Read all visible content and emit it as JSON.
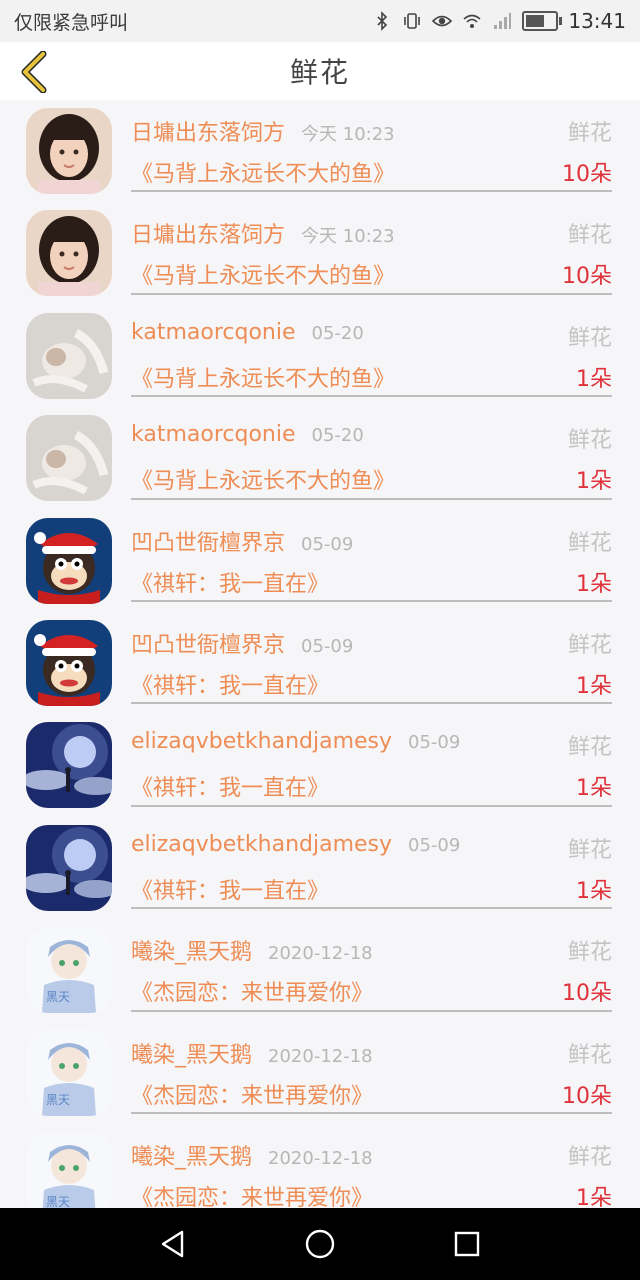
{
  "status_bar": {
    "carrier_text": "仅限紧急呼叫",
    "time": "13:41",
    "icons": [
      "bluetooth-icon",
      "vibrate-icon",
      "eye-icon",
      "wifi-icon",
      "signal-icon",
      "battery-icon"
    ]
  },
  "header": {
    "title": "鲜花",
    "back_icon": "chevron-left-icon",
    "back_color": "#e7c43b"
  },
  "colors": {
    "name": "#ee8d55",
    "count": "#e0323a",
    "muted": "#c4c4c4"
  },
  "items": [
    {
      "name": "日墉出东落饲方",
      "date": "今天 10:23",
      "type": "鲜花",
      "book": "《马背上永远长不大的鱼》",
      "count": "10朵",
      "avatar": "girl"
    },
    {
      "name": "日墉出东落饲方",
      "date": "今天 10:23",
      "type": "鲜花",
      "book": "《马背上永远长不大的鱼》",
      "count": "10朵",
      "avatar": "girl"
    },
    {
      "name": "katmaorcqonie",
      "date": "05-20",
      "type": "鲜花",
      "book": "《马背上永远长不大的鱼》",
      "count": "1朵",
      "avatar": "cat"
    },
    {
      "name": "katmaorcqonie",
      "date": "05-20",
      "type": "鲜花",
      "book": "《马背上永远长不大的鱼》",
      "count": "1朵",
      "avatar": "cat"
    },
    {
      "name": "凹凸世衙檀界京",
      "date": "05-09",
      "type": "鲜花",
      "book": "《祺轩：我一直在》",
      "count": "1朵",
      "avatar": "monkey"
    },
    {
      "name": "凹凸世衙檀界京",
      "date": "05-09",
      "type": "鲜花",
      "book": "《祺轩：我一直在》",
      "count": "1朵",
      "avatar": "monkey"
    },
    {
      "name": "elizaqvbetkhandjamesy",
      "date": "05-09",
      "type": "鲜花",
      "book": "《祺轩：我一直在》",
      "count": "1朵",
      "avatar": "night"
    },
    {
      "name": "elizaqvbetkhandjamesy",
      "date": "05-09",
      "type": "鲜花",
      "book": "《祺轩：我一直在》",
      "count": "1朵",
      "avatar": "night"
    },
    {
      "name": "曦染_黑天鹅",
      "date": "2020-12-18",
      "type": "鲜花",
      "book": "《杰园恋：来世再爱你》",
      "count": "10朵",
      "avatar": "anime"
    },
    {
      "name": "曦染_黑天鹅",
      "date": "2020-12-18",
      "type": "鲜花",
      "book": "《杰园恋：来世再爱你》",
      "count": "10朵",
      "avatar": "anime"
    },
    {
      "name": "曦染_黑天鹅",
      "date": "2020-12-18",
      "type": "鲜花",
      "book": "《杰园恋：来世再爱你》",
      "count": "1朵",
      "avatar": "anime"
    }
  ],
  "nav_bar": {
    "buttons": [
      "back-triangle-icon",
      "home-circle-icon",
      "recents-square-icon"
    ]
  }
}
